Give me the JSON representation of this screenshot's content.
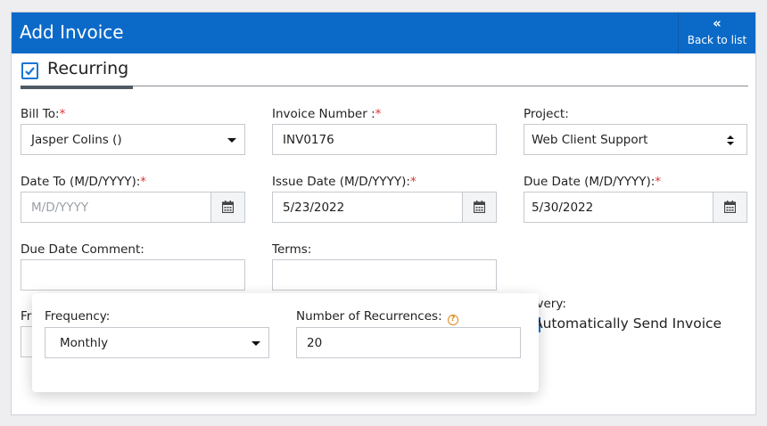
{
  "header": {
    "title": "Add Invoice",
    "back_label": "Back to list",
    "back_icon": "chevrons-left-icon"
  },
  "recurring": {
    "label": "Recurring",
    "checked": true
  },
  "bill_to": {
    "label": "Bill To:",
    "required": "*",
    "value": "Jasper Colins ()"
  },
  "invoice_number": {
    "label": "Invoice Number :",
    "required": "*",
    "value": "INV0176"
  },
  "project": {
    "label": "Project:",
    "value": "Web Client Support"
  },
  "date_to": {
    "label": "Date To (M/D/YYYY):",
    "required": "*",
    "placeholder": "M/D/YYYY"
  },
  "issue_date": {
    "label": "Issue Date (M/D/YYYY):",
    "required": "*",
    "value": "5/23/2022"
  },
  "due_date": {
    "label": "Due Date (M/D/YYYY):",
    "required": "*",
    "value": "5/30/2022"
  },
  "due_date_comment": {
    "label": "Due Date Comment:",
    "value": ""
  },
  "terms": {
    "label": "Terms:",
    "value": ""
  },
  "background_label_fragment": "Fr",
  "delivery": {
    "label_fragment": "livery:",
    "auto_send_label": "Automatically Send Invoice"
  },
  "popup": {
    "frequency": {
      "label": "Frequency:",
      "value": "Monthly"
    },
    "recurrences": {
      "label": "Number of Recurrences:",
      "value": "20",
      "help_glyph": "?"
    }
  },
  "colors": {
    "header_bg": "#0b6ac8",
    "accent": "#1877d2",
    "required": "#d33333",
    "help": "#e08a1e"
  }
}
